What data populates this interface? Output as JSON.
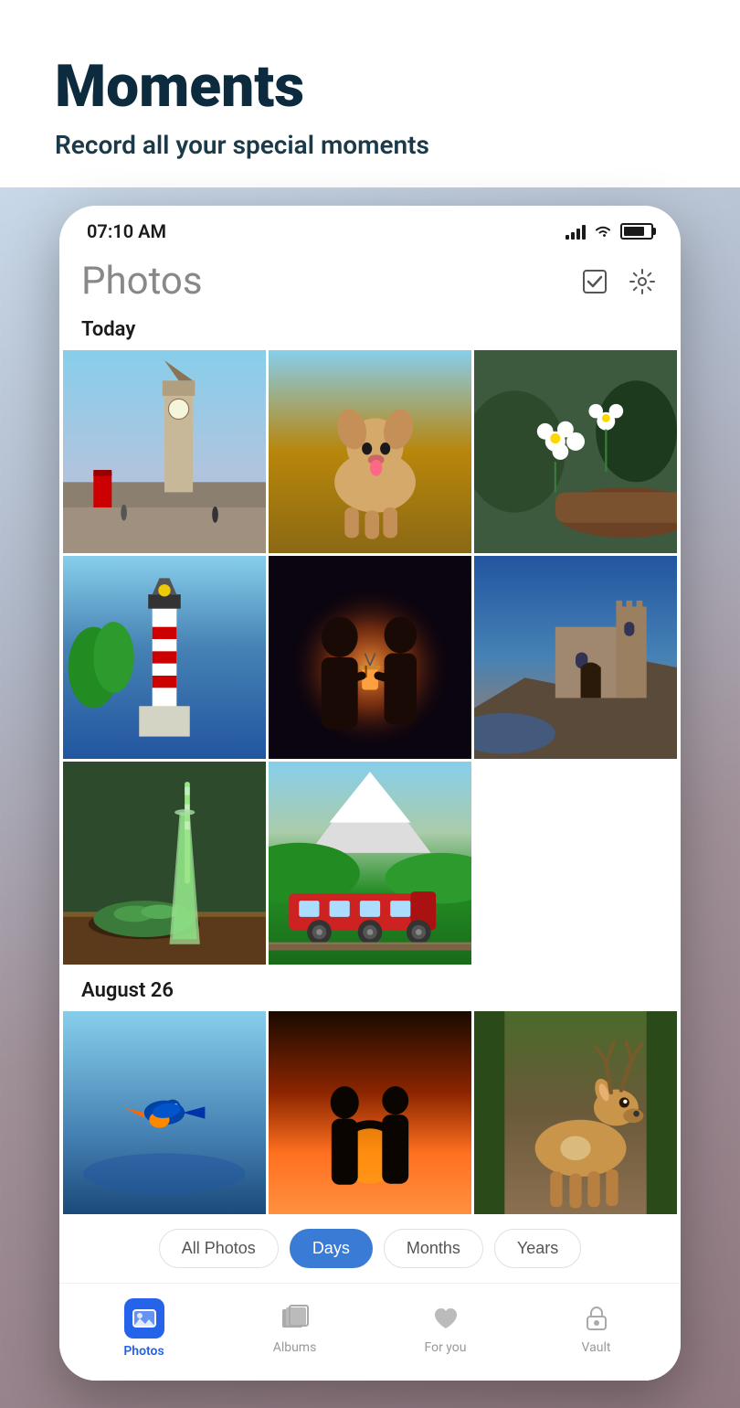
{
  "header": {
    "title": "Moments",
    "subtitle": "Record all your special moments"
  },
  "status_bar": {
    "time": "07:10 AM"
  },
  "photos_screen": {
    "title": "Photos",
    "section_today": "Today",
    "section_august": "August 26",
    "toolbar": {
      "select_label": "select",
      "settings_label": "settings"
    }
  },
  "filter_tabs": [
    {
      "id": "all",
      "label": "All Photos",
      "active": false
    },
    {
      "id": "days",
      "label": "Days",
      "active": true
    },
    {
      "id": "months",
      "label": "Months",
      "active": false
    },
    {
      "id": "years",
      "label": "Years",
      "active": false
    }
  ],
  "bottom_nav": [
    {
      "id": "photos",
      "label": "Photos",
      "active": true
    },
    {
      "id": "albums",
      "label": "Albums",
      "active": false
    },
    {
      "id": "foryou",
      "label": "For you",
      "active": false
    },
    {
      "id": "vault",
      "label": "Vault",
      "active": false
    }
  ],
  "photos_today": [
    {
      "id": "london",
      "alt": "Big Ben London street"
    },
    {
      "id": "dog",
      "alt": "Golden retriever dog"
    },
    {
      "id": "flowers",
      "alt": "White flowers on log"
    },
    {
      "id": "lighthouse",
      "alt": "Lighthouse by sea"
    },
    {
      "id": "couple",
      "alt": "Couple with lantern"
    },
    {
      "id": "castle",
      "alt": "Castle on cliff"
    },
    {
      "id": "smoothie",
      "alt": "Green smoothie drink"
    },
    {
      "id": "train",
      "alt": "Red train in mountains"
    }
  ],
  "photos_aug26": [
    {
      "id": "bird",
      "alt": "Bird by water"
    },
    {
      "id": "couple2",
      "alt": "Couple at sunset"
    },
    {
      "id": "deer",
      "alt": "Deer in forest"
    }
  ]
}
